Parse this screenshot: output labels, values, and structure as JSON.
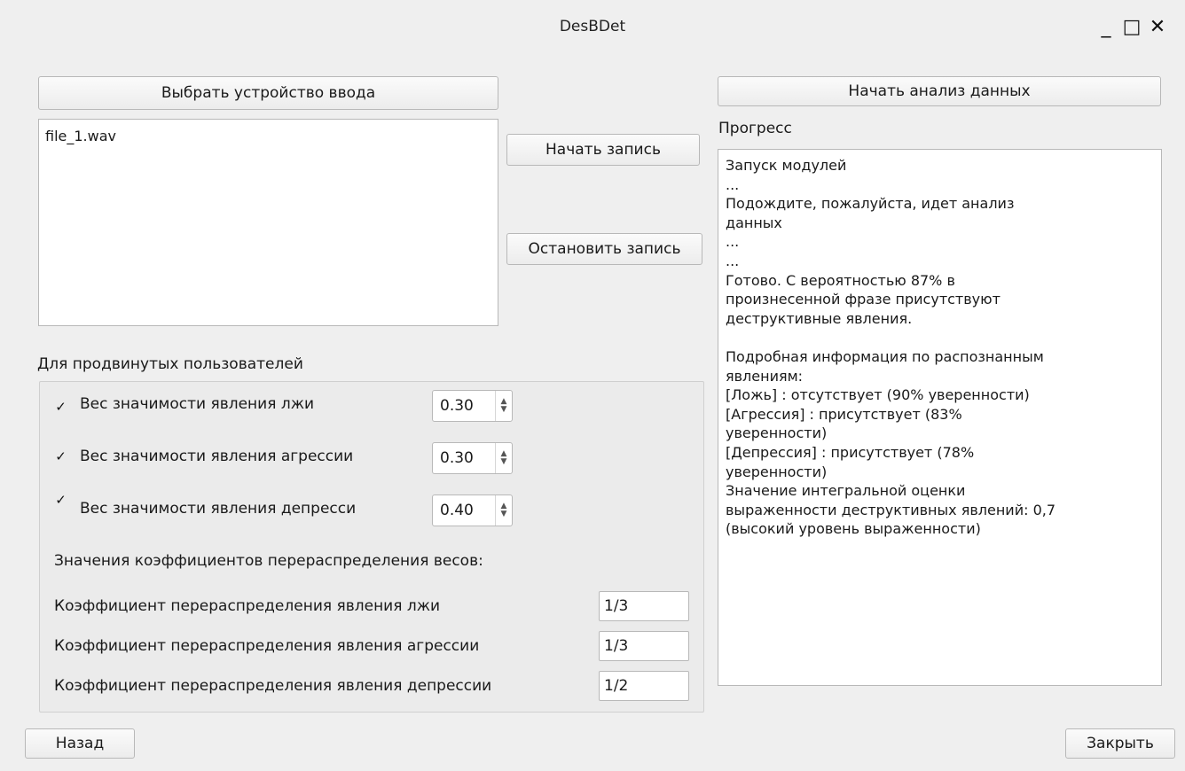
{
  "window": {
    "title": "DesBDet",
    "minimize_glyph": "_",
    "maximize_glyph": "□",
    "close_glyph": "✕"
  },
  "left": {
    "select_device_button": "Выбрать устройство ввода",
    "files": [
      "file_1.wav"
    ],
    "start_record_button": "Начать запись",
    "stop_record_button": "Остановить запись"
  },
  "advanced": {
    "title": "Для продвинутых пользователей",
    "weights": [
      {
        "label": "Вес значимости явления лжи",
        "checked": true,
        "value": "0.30"
      },
      {
        "label": "Вес значимости явления агрессии",
        "checked": true,
        "value": "0.30"
      },
      {
        "label": "Вес значимости явления депресси",
        "checked": true,
        "value": "0.40"
      }
    ],
    "coefficients_title": "Значения коэффициентов перераспределения весов:",
    "coefficients": [
      {
        "label": "Коэффициент перераспределения явления лжи",
        "value": "1/3"
      },
      {
        "label": "Коэффициент перераспределения явления агрессии",
        "value": "1/3"
      },
      {
        "label": "Коэффициент перераспределения явления депрессии",
        "value": "1/2"
      }
    ]
  },
  "right": {
    "start_analysis_button": "Начать анализ данных",
    "progress_label": "Прогресс",
    "progress_text": "Запуск модулей\n...\nПодождите, пожалуйста, идет анализ\nданных\n...\n...\nГотово. С вероятностью 87% в\nпроизнесенной фразе присутствуют\nдеструктивные явления.\n\nПодробная информация по распознанным\nявлениям:\n[Ложь] : отсутствует (90% уверенности)\n[Агрессия] : присутствует (83%\nуверенности)\n[Депрессия] : присутствует (78%\nуверенности)\nЗначение интегральной оценки\nвыраженности деструктивных явлений: 0,7\n(высокий уровень выраженности)"
  },
  "footer": {
    "back_button": "Назад",
    "close_button": "Закрыть"
  },
  "icons": {
    "check": "✓",
    "spin_up": "▲",
    "spin_down": "▼"
  }
}
